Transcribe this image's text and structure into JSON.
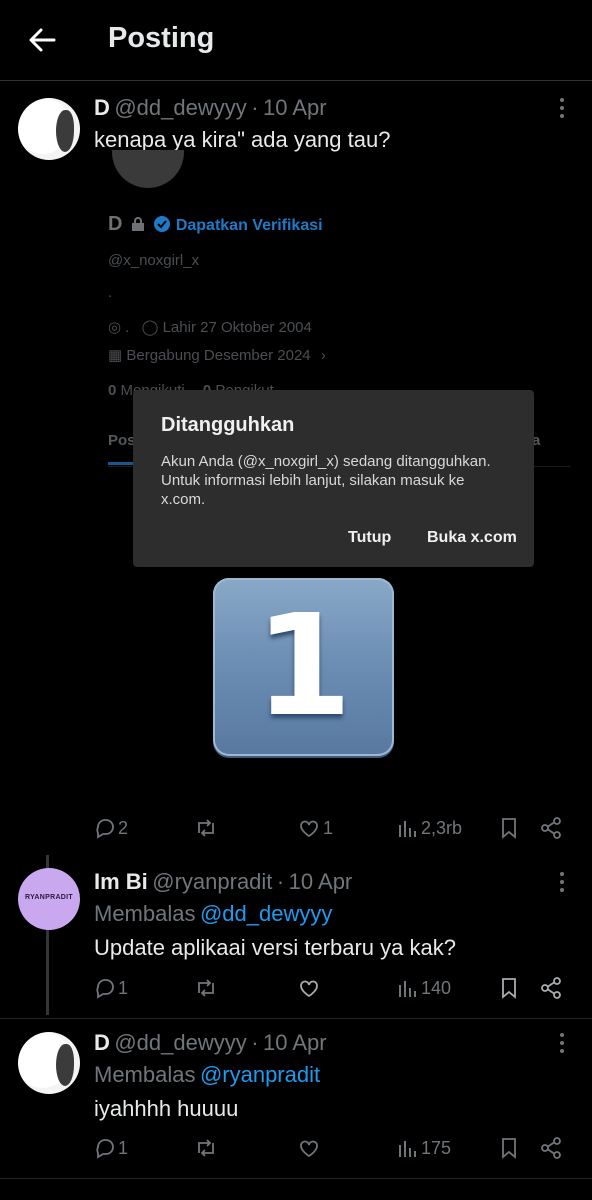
{
  "header": {
    "title": "Posting"
  },
  "post": {
    "name": "D",
    "handle": "@dd_dewyyy",
    "sep": "·",
    "date": "10 Apr",
    "text": "kenapa ya kira\" ada yang tau?",
    "screenshot": {
      "name": "D",
      "verify_label": "Dapatkan Verifikasi",
      "handle": "@x_noxgirl_x",
      "bio": ".",
      "location": ".",
      "birth": "Lahir 27 Oktober 2004",
      "joined": "Bergabung Desember 2024",
      "following": "0",
      "following_label": "Mengikuti",
      "followers": "0",
      "followers_label": "Pengikut",
      "tab_left": "Pos",
      "tab_right": "a",
      "dialog": {
        "title": "Ditangguhkan",
        "message": "Akun Anda (@x_noxgirl_x) sedang ditangguhkan. Untuk informasi lebih lanjut, silakan masuk ke x.com.",
        "close_label": "Tutup",
        "open_label": "Buka x.com"
      },
      "key_number": "1"
    },
    "actions": {
      "replies": "2",
      "likes": "1",
      "views": "2,3rb"
    }
  },
  "replies": [
    {
      "name": "Im Bi",
      "handle": "@ryanpradit",
      "sep": "·",
      "date": "10 Apr",
      "reply_prefix": "Membalas",
      "reply_to": "@dd_dewyyy",
      "text": "Update aplikaai versi terbaru ya kak?",
      "avatar_text": "RYANPRADIT",
      "actions": {
        "replies": "1",
        "likes": "",
        "views": "140"
      }
    },
    {
      "name": "D",
      "handle": "@dd_dewyyy",
      "sep": "·",
      "date": "10 Apr",
      "reply_prefix": "Membalas",
      "reply_to": "@ryanpradit",
      "text": "iyahhhh huuuu",
      "actions": {
        "replies": "1",
        "likes": "",
        "views": "175"
      }
    }
  ],
  "colors": {
    "accent": "#1d9bf0",
    "muted": "#71767b",
    "background": "#000000",
    "dialog": "#2d2d2d"
  }
}
